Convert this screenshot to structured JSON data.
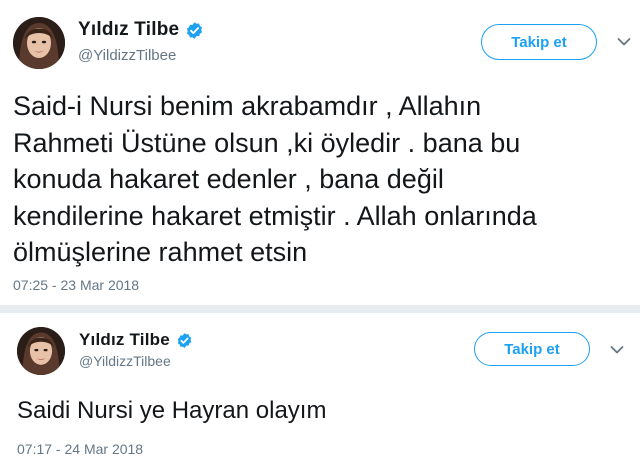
{
  "tweets": [
    {
      "author": {
        "display_name": "Yıldız Tilbe",
        "handle": "@YildizzTilbee",
        "verified_icon": "verified-badge-icon",
        "avatar": "avatar-photo"
      },
      "follow_label": "Takip et",
      "menu_icon": "chevron-down-icon",
      "text": "Said-i Nursi benim akrabamdır , Allahın\nRahmeti Üstüne olsun ,ki öyledir . bana bu\nkonuda hakaret edenler , bana değil\nkendilerine hakaret etmiştir . Allah onlarında\nölmüşlerine rahmet etsin",
      "timestamp": "07:25 - 23 Mar 2018"
    },
    {
      "author": {
        "display_name": "Yıldız Tilbe",
        "handle": "@YildizzTilbee",
        "verified_icon": "verified-badge-icon",
        "avatar": "avatar-photo"
      },
      "follow_label": "Takip et",
      "menu_icon": "chevron-down-icon",
      "text": "Saidi Nursi ye Hayran olayım",
      "timestamp": "07:17 - 24 Mar 2018"
    }
  ],
  "colors": {
    "accent": "#1da1f2",
    "secondary_text": "#657786",
    "primary_text": "#14171a",
    "separator": "#e6ecf0"
  }
}
